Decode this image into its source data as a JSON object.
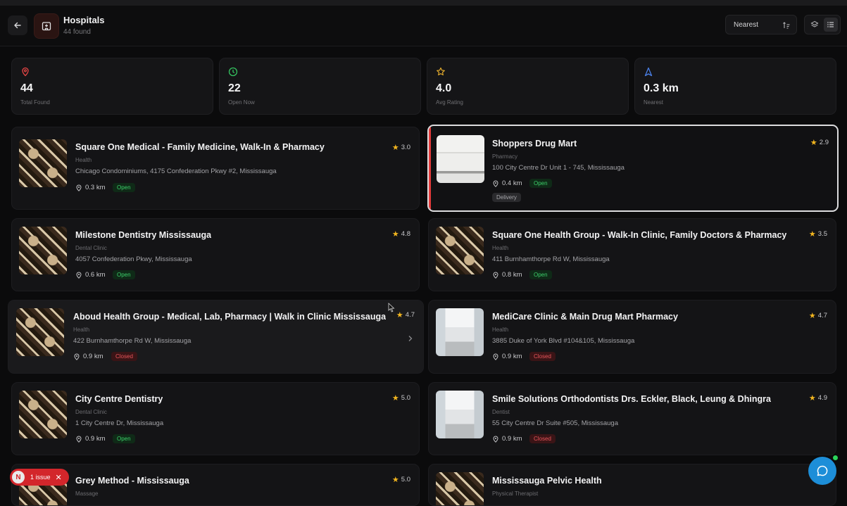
{
  "header": {
    "title": "Hospitals",
    "subtitle": "44 found",
    "sort_label": "Nearest"
  },
  "stats": [
    {
      "icon": "pin-icon",
      "value": "44",
      "label": "Total Found",
      "color": "#e64545"
    },
    {
      "icon": "clock-icon",
      "value": "22",
      "label": "Open Now",
      "color": "#34c25f"
    },
    {
      "icon": "star-icon",
      "value": "4.0",
      "label": "Avg Rating",
      "color": "#e0a92c"
    },
    {
      "icon": "navigation-icon",
      "value": "0.3 km",
      "label": "Nearest",
      "color": "#4a7fe6"
    }
  ],
  "places": [
    {
      "name": "Square One Medical - Family Medicine, Walk-In & Pharmacy",
      "category": "Health",
      "address": "Chicago Condominiums, 4175 Confederation Pkwy #2, Mississauga",
      "distance": "0.3 km",
      "status": "Open",
      "rating": "3.0"
    },
    {
      "name": "Shoppers Drug Mart",
      "category": "Pharmacy",
      "address": "100 City Centre Dr Unit 1 - 745, Mississauga",
      "distance": "0.4 km",
      "status": "Open",
      "rating": "2.9",
      "tag": "Delivery"
    },
    {
      "name": "Milestone Dentistry Mississauga",
      "category": "Dental Clinic",
      "address": "4057 Confederation Pkwy, Mississauga",
      "distance": "0.6 km",
      "status": "Open",
      "rating": "4.8"
    },
    {
      "name": "Square One Health Group - Walk-In Clinic, Family Doctors & Pharmacy",
      "category": "Health",
      "address": "411 Burnhamthorpe Rd W, Mississauga",
      "distance": "0.8 km",
      "status": "Open",
      "rating": "3.5"
    },
    {
      "name": "Aboud Health Group - Medical, Lab, Pharmacy | Walk in Clinic Mississauga",
      "category": "Health",
      "address": "422 Burnhamthorpe Rd W, Mississauga",
      "distance": "0.9 km",
      "status": "Closed",
      "rating": "4.7"
    },
    {
      "name": "MediCare Clinic & Main Drug Mart Pharmacy",
      "category": "Health",
      "address": "3885 Duke of York Blvd #104&105, Mississauga",
      "distance": "0.9 km",
      "status": "Closed",
      "rating": "4.7"
    },
    {
      "name": "City Centre Dentistry",
      "category": "Dental Clinic",
      "address": "1 City Centre Dr, Mississauga",
      "distance": "0.9 km",
      "status": "Open",
      "rating": "5.0"
    },
    {
      "name": "Smile Solutions Orthodontists Drs. Eckler, Black, Leung & Dhingra",
      "category": "Dentist",
      "address": "55 City Centre Dr Suite #505, Mississauga",
      "distance": "0.9 km",
      "status": "Closed",
      "rating": "4.9"
    },
    {
      "name": "Grey Method - Mississauga",
      "category": "Massage",
      "rating": "5.0"
    },
    {
      "name": "Mississauga Pelvic Health",
      "category": "Physical Therapist"
    }
  ],
  "issue_badge": {
    "initial": "N",
    "text": "1 issue"
  }
}
